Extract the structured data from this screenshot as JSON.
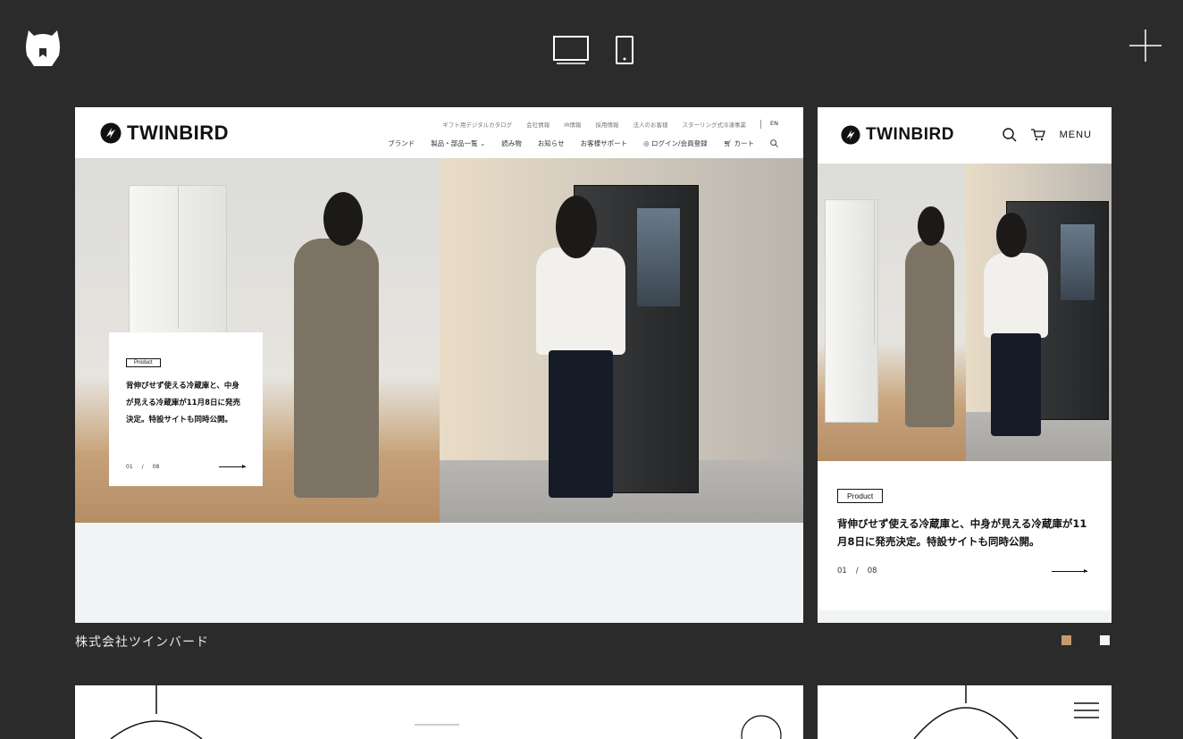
{
  "topbar": {
    "logo_icon": "bear-logo-icon",
    "device_desktop_icon": "desktop-monitor-icon",
    "device_mobile_icon": "mobile-phone-icon",
    "menu_icon": "plus-icon"
  },
  "desktop_site": {
    "brand": "TWINBIRD",
    "util_links": [
      "ギフト用デジタルカタログ",
      "会社情報",
      "IR情報",
      "採用情報",
      "法人のお客様",
      "スターリング式冷凍事業",
      "EN"
    ],
    "nav_links": [
      "ブランド",
      "製品・部品一覧 ⌄",
      "読み物",
      "お知らせ",
      "お客様サポート",
      "ログイン/会員登録",
      "カート"
    ],
    "tag": "Product",
    "headline": "背伸びせず使える冷蔵庫と、中身が見える冷蔵庫が11月8日に発売決定。特設サイトも同時公開。",
    "pager_current": "01",
    "pager_sep": "/",
    "pager_total": "08"
  },
  "mobile_site": {
    "brand": "TWINBIRD",
    "menu_label": "MENU",
    "tag": "Product",
    "headline": "背伸びせず使える冷蔵庫と、中身が見える冷蔵庫が11月8日に発売決定。特設サイトも同時公開。",
    "pager_current": "01",
    "pager_sep": "/",
    "pager_total": "08"
  },
  "entry": {
    "caption": "株式会社ツインバード",
    "colors": [
      "#c59a6e",
      "#f4f4f2"
    ]
  }
}
